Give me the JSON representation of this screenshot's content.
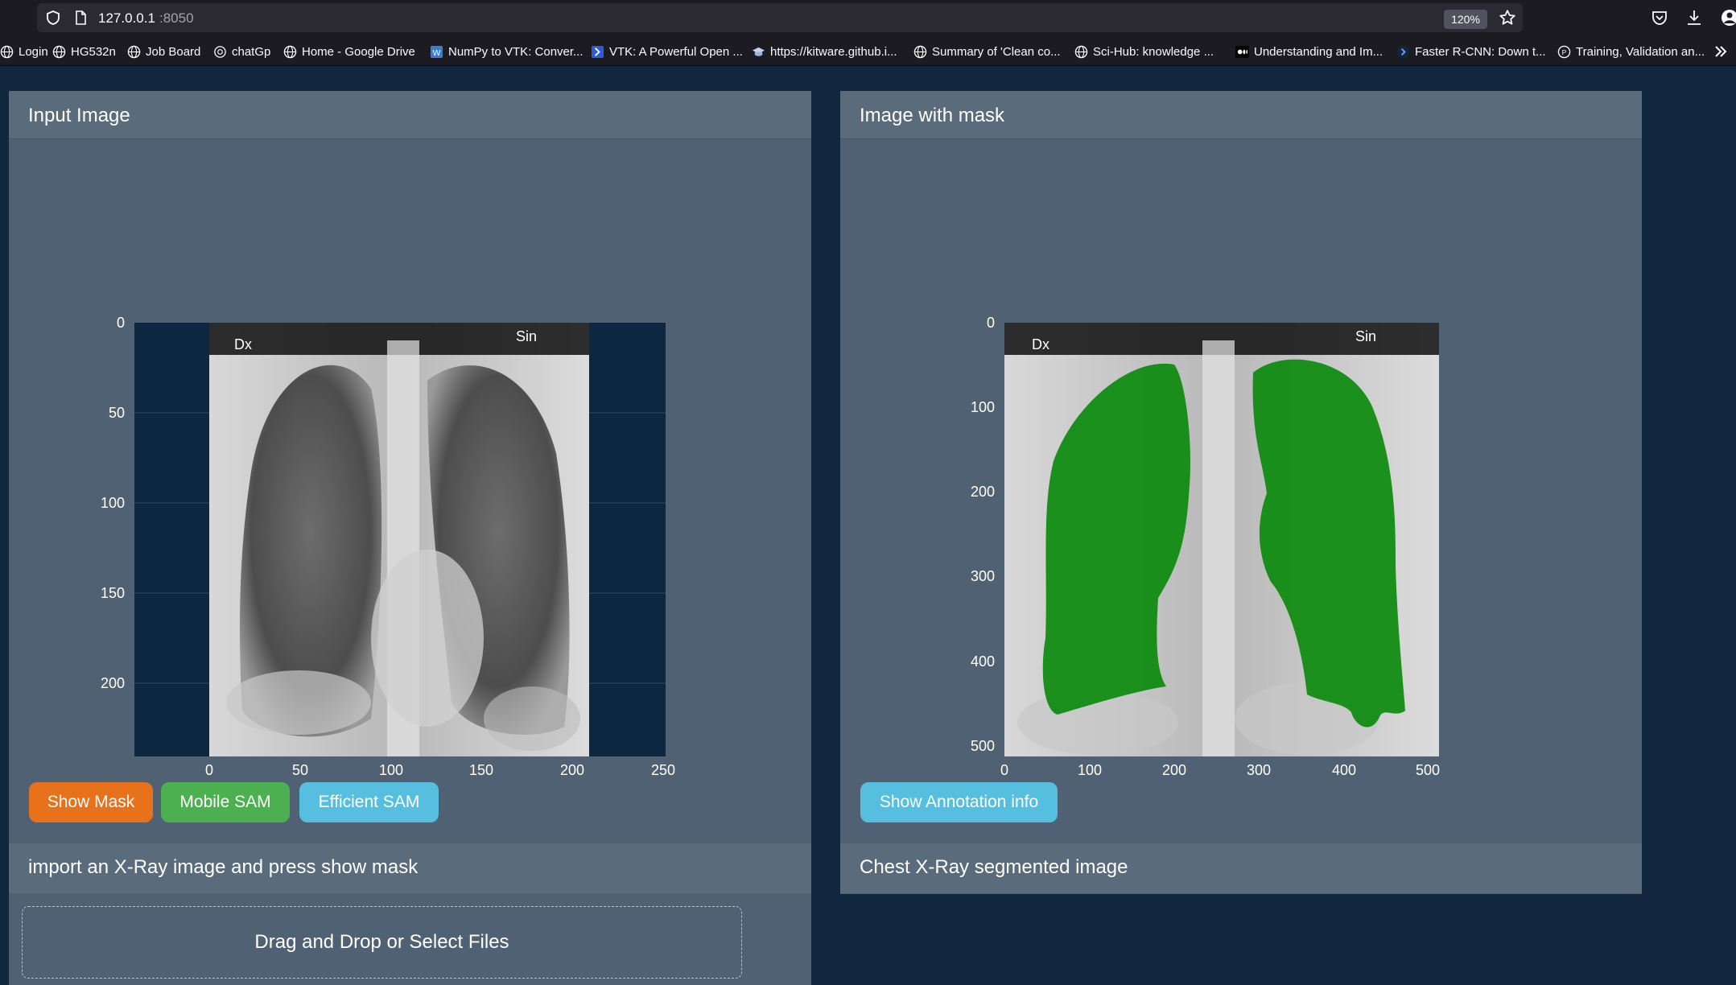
{
  "browser": {
    "url_host": "127.0.0.1",
    "url_port": ":8050",
    "zoom": "120%",
    "bookmarks": [
      {
        "label": "Login",
        "icon": "globe-icon"
      },
      {
        "label": "HG532n",
        "icon": "globe-icon"
      },
      {
        "label": "Job Board",
        "icon": "globe-icon"
      },
      {
        "label": "chatGp",
        "icon": "openai-icon"
      },
      {
        "label": "Home - Google Drive",
        "icon": "globe-icon"
      },
      {
        "label": "NumPy to VTK: Conver...",
        "icon": "wordpress-icon"
      },
      {
        "label": "VTK: A Powerful Open ...",
        "icon": "vtk-icon"
      },
      {
        "label": "https://kitware.github.i...",
        "icon": "graduation-cap-icon"
      },
      {
        "label": "Summary of 'Clean co...",
        "icon": "globe-icon"
      },
      {
        "label": "Sci-Hub: knowledge ...",
        "icon": "globe-icon"
      },
      {
        "label": "Understanding and Im...",
        "icon": "medium-icon"
      },
      {
        "label": "Faster R-CNN: Down t...",
        "icon": "arrow-icon"
      },
      {
        "label": "Training, Validation an...",
        "icon": "circle-p-icon"
      }
    ]
  },
  "left_panel": {
    "title": "Input Image",
    "buttons": {
      "show_mask": "Show Mask",
      "mobile_sam": "Mobile SAM",
      "efficient_sam": "Efficient SAM"
    },
    "footer": "import an X-Ray image and press show mask",
    "upload_label": "Drag and Drop or Select Files",
    "image_labels": {
      "left": "Dx",
      "right": "Sin"
    },
    "chart": {
      "x_ticks": [
        "0",
        "50",
        "100",
        "150",
        "200",
        "250"
      ],
      "y_ticks": [
        "0",
        "50",
        "100",
        "150",
        "200"
      ]
    }
  },
  "right_panel": {
    "title": "Image with mask",
    "button": "Show Annotation info",
    "footer": "Chest X-Ray segmented image",
    "image_labels": {
      "left": "Dx",
      "right": "Sin"
    },
    "chart": {
      "x_ticks": [
        "0",
        "100",
        "200",
        "300",
        "400",
        "500"
      ],
      "y_ticks": [
        "0",
        "100",
        "200",
        "300",
        "400",
        "500"
      ]
    }
  },
  "colors": {
    "show_mask": "#e8711c",
    "mobile_sam": "#4cb050",
    "efficient_sam": "#56bfe0",
    "annotation": "#56bfe0",
    "mask_green": "#0c8a0c"
  }
}
